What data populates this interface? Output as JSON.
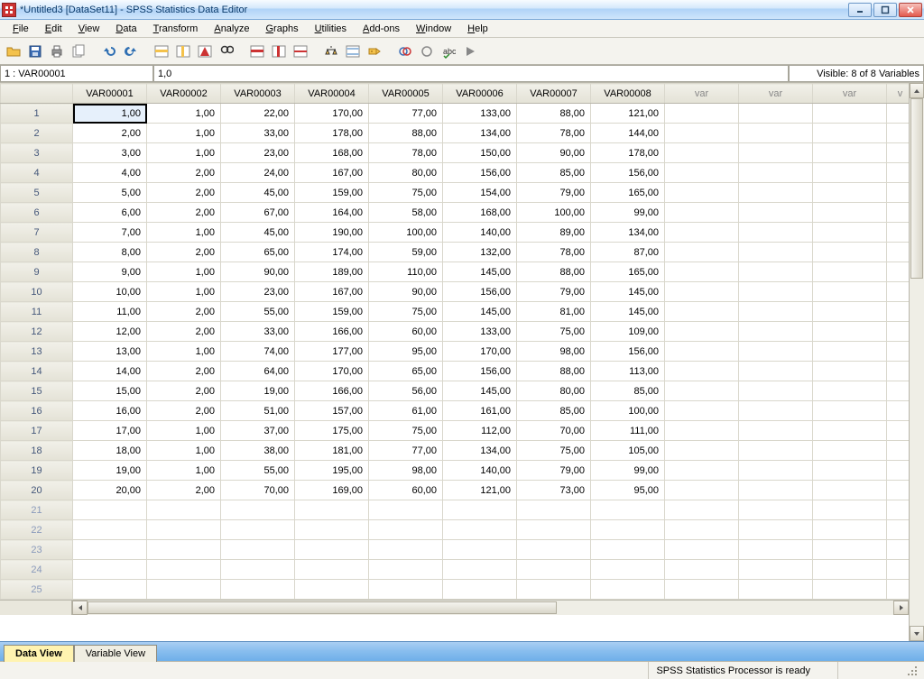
{
  "title": "*Untitled3 [DataSet11] - SPSS Statistics Data Editor",
  "menu": [
    "File",
    "Edit",
    "View",
    "Data",
    "Transform",
    "Analyze",
    "Graphs",
    "Utilities",
    "Add-ons",
    "Window",
    "Help"
  ],
  "toolbar_icons": [
    "open",
    "save",
    "print",
    "recent",
    "undo",
    "redo",
    "goto-case",
    "goto-var",
    "goto-imputation",
    "find",
    "insert-case",
    "insert-var",
    "split-file",
    "weight",
    "select-cases",
    "value-labels",
    "use-sets",
    "show-all",
    "spellcheck",
    "run"
  ],
  "info": {
    "cell_ref": "1 : VAR00001",
    "cell_value": "1,0",
    "visible": "Visible: 8 of 8 Variables"
  },
  "columns": [
    "VAR00001",
    "VAR00002",
    "VAR00003",
    "VAR00004",
    "VAR00005",
    "VAR00006",
    "VAR00007",
    "VAR00008",
    "var",
    "var",
    "var",
    "v"
  ],
  "rows": [
    [
      "1,00",
      "1,00",
      "22,00",
      "170,00",
      "77,00",
      "133,00",
      "88,00",
      "121,00"
    ],
    [
      "2,00",
      "1,00",
      "33,00",
      "178,00",
      "88,00",
      "134,00",
      "78,00",
      "144,00"
    ],
    [
      "3,00",
      "1,00",
      "23,00",
      "168,00",
      "78,00",
      "150,00",
      "90,00",
      "178,00"
    ],
    [
      "4,00",
      "2,00",
      "24,00",
      "167,00",
      "80,00",
      "156,00",
      "85,00",
      "156,00"
    ],
    [
      "5,00",
      "2,00",
      "45,00",
      "159,00",
      "75,00",
      "154,00",
      "79,00",
      "165,00"
    ],
    [
      "6,00",
      "2,00",
      "67,00",
      "164,00",
      "58,00",
      "168,00",
      "100,00",
      "99,00"
    ],
    [
      "7,00",
      "1,00",
      "45,00",
      "190,00",
      "100,00",
      "140,00",
      "89,00",
      "134,00"
    ],
    [
      "8,00",
      "2,00",
      "65,00",
      "174,00",
      "59,00",
      "132,00",
      "78,00",
      "87,00"
    ],
    [
      "9,00",
      "1,00",
      "90,00",
      "189,00",
      "110,00",
      "145,00",
      "88,00",
      "165,00"
    ],
    [
      "10,00",
      "1,00",
      "23,00",
      "167,00",
      "90,00",
      "156,00",
      "79,00",
      "145,00"
    ],
    [
      "11,00",
      "2,00",
      "55,00",
      "159,00",
      "75,00",
      "145,00",
      "81,00",
      "145,00"
    ],
    [
      "12,00",
      "2,00",
      "33,00",
      "166,00",
      "60,00",
      "133,00",
      "75,00",
      "109,00"
    ],
    [
      "13,00",
      "1,00",
      "74,00",
      "177,00",
      "95,00",
      "170,00",
      "98,00",
      "156,00"
    ],
    [
      "14,00",
      "2,00",
      "64,00",
      "170,00",
      "65,00",
      "156,00",
      "88,00",
      "113,00"
    ],
    [
      "15,00",
      "2,00",
      "19,00",
      "166,00",
      "56,00",
      "145,00",
      "80,00",
      "85,00"
    ],
    [
      "16,00",
      "2,00",
      "51,00",
      "157,00",
      "61,00",
      "161,00",
      "85,00",
      "100,00"
    ],
    [
      "17,00",
      "1,00",
      "37,00",
      "175,00",
      "75,00",
      "112,00",
      "70,00",
      "111,00"
    ],
    [
      "18,00",
      "1,00",
      "38,00",
      "181,00",
      "77,00",
      "134,00",
      "75,00",
      "105,00"
    ],
    [
      "19,00",
      "1,00",
      "55,00",
      "195,00",
      "98,00",
      "140,00",
      "79,00",
      "99,00"
    ],
    [
      "20,00",
      "2,00",
      "70,00",
      "169,00",
      "60,00",
      "121,00",
      "73,00",
      "95,00"
    ]
  ],
  "empty_rows": [
    "21",
    "22",
    "23",
    "24",
    "25"
  ],
  "selected": {
    "row": 0,
    "col": 0
  },
  "tabs": {
    "data": "Data View",
    "variable": "Variable View"
  },
  "status": "SPSS Statistics Processor is ready"
}
